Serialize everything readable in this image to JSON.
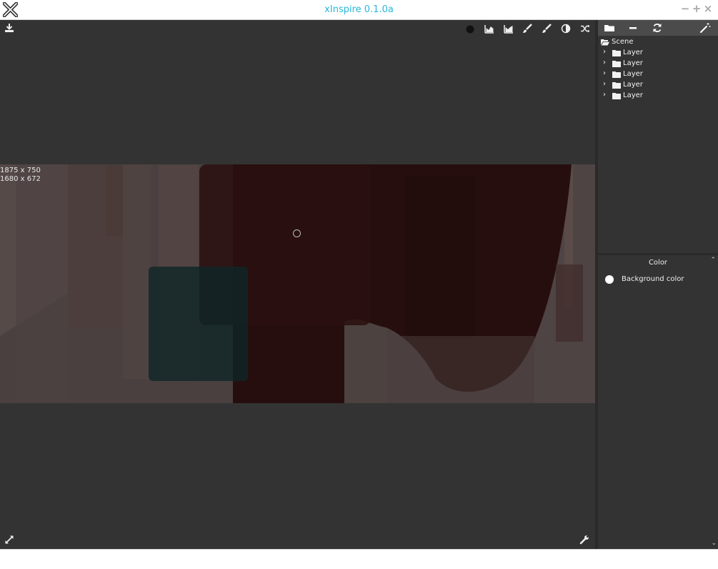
{
  "app": {
    "title": "xInspire 0.1.0a",
    "window_controls": {
      "minimize": "−",
      "maximize": "+",
      "close": "×"
    },
    "accent_color": "#29b8d9"
  },
  "toolbar": {
    "left_icons": [
      "download-icon"
    ],
    "right_icons": [
      "circle-icon",
      "chart-area-icon",
      "chart-area-alt-icon",
      "paint-brush-icon",
      "paint-brush-alt-icon",
      "contrast-icon",
      "shuffle-icon"
    ]
  },
  "canvas": {
    "size_primary": "1875 x 750",
    "size_secondary": "1680 x 672",
    "background_color": "#463c3c"
  },
  "bottom_icons": {
    "left": "expand-icon",
    "right": "wrench-icon"
  },
  "sidebar": {
    "toolbar_icons": [
      "folder-icon",
      "minus-icon",
      "refresh-icon",
      "magic-wand-icon"
    ],
    "tree": {
      "root": "Scene",
      "layers": [
        "Layer",
        "Layer",
        "Layer",
        "Layer",
        "Layer"
      ]
    },
    "properties": {
      "title": "Color",
      "items": [
        {
          "label": "Background color",
          "color": "#ffffff"
        }
      ]
    }
  }
}
